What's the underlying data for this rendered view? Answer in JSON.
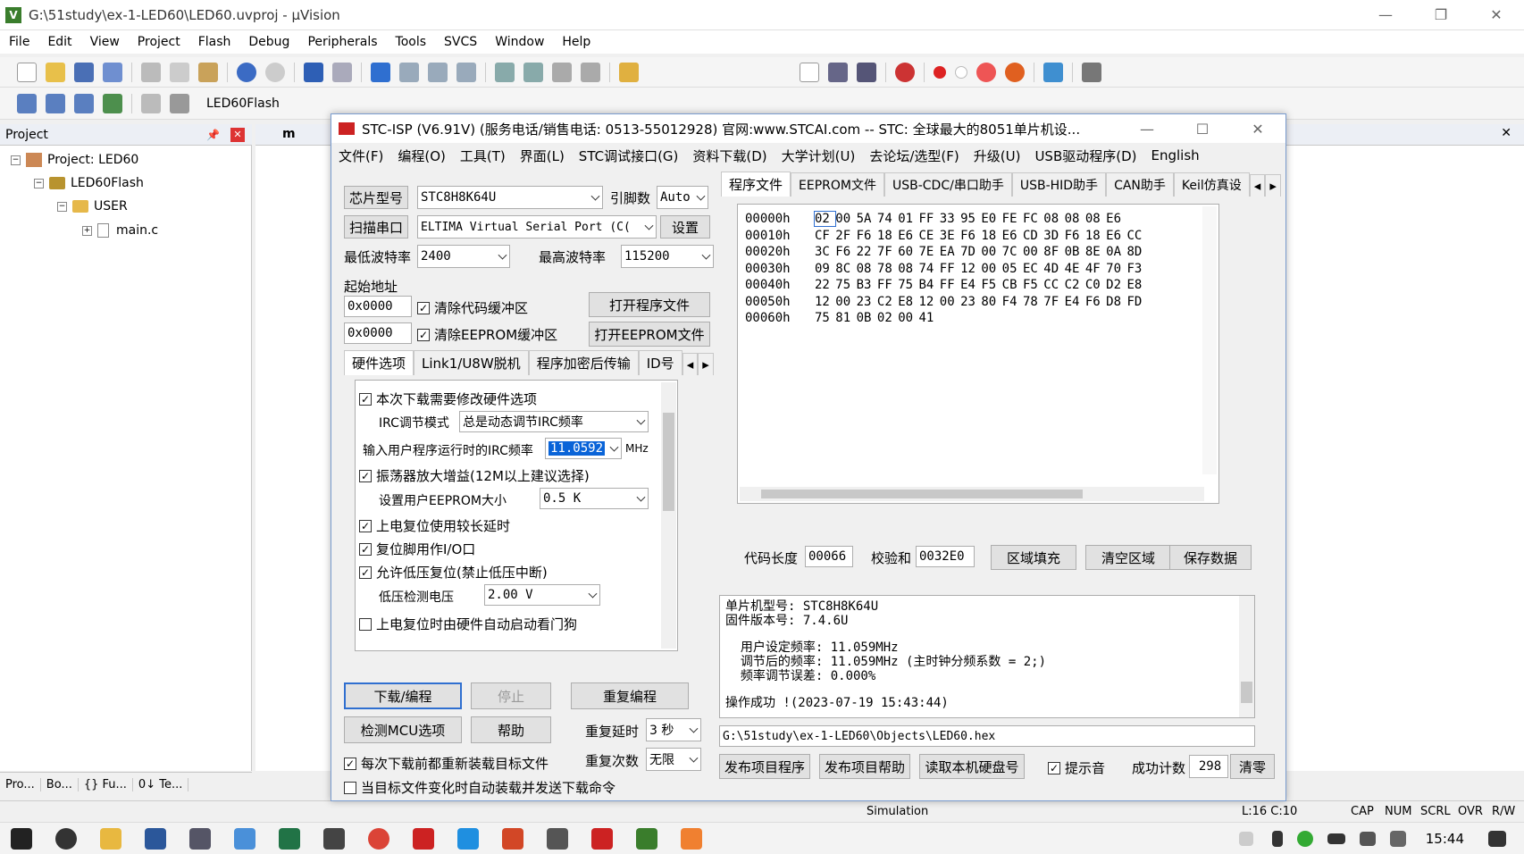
{
  "window_title": "G:\\51study\\ex-1-LED60\\LED60.uvproj - µVision",
  "menu": [
    "File",
    "Edit",
    "View",
    "Project",
    "Flash",
    "Debug",
    "Peripherals",
    "Tools",
    "SVCS",
    "Window",
    "Help"
  ],
  "target_name": "LED60Flash",
  "project_panel": {
    "title": "Project",
    "root": "Project: LED60",
    "target": "LED60Flash",
    "group": "USER",
    "file": "main.c",
    "tabs": [
      "Pro...",
      "Bo...",
      "{} Fu...",
      "0↓ Te..."
    ]
  },
  "editor_tab": "m",
  "statusbar": {
    "mode": "Simulation",
    "pos": "L:16 C:10",
    "flags": [
      "CAP",
      "NUM",
      "SCRL",
      "OVR",
      "R/W"
    ]
  },
  "taskbar": {
    "time": "15:44"
  },
  "stc": {
    "title": "STC-ISP (V6.91V) (服务电话/销售电话: 0513-55012928) 官网:www.STCAI.com  -- STC: 全球最大的8051单片机设...",
    "menu": [
      "文件(F)",
      "编程(O)",
      "工具(T)",
      "界面(L)",
      "STC调试接口(G)",
      "资料下载(D)",
      "大学计划(U)",
      "去论坛/选型(F)",
      "升级(U)",
      "USB驱动程序(D)",
      "English"
    ],
    "chip_btn": "芯片型号",
    "chip_value": "STC8H8K64U",
    "pins_label": "引脚数",
    "pins_value": "Auto",
    "scan_btn": "扫描串口",
    "port_value": "ELTIMA Virtual Serial Port (C(",
    "settings_btn": "设置",
    "min_baud_label": "最低波特率",
    "min_baud": "2400",
    "max_baud_label": "最高波特率",
    "max_baud": "115200",
    "start_addr_label": "起始地址",
    "addr1": "0x0000",
    "clear_code": "清除代码缓冲区",
    "open_prog": "打开程序文件",
    "addr2": "0x0000",
    "clear_eeprom": "清除EEPROM缓冲区",
    "open_eeprom": "打开EEPROM文件",
    "hw_tabs": [
      "硬件选项",
      "Link1/U8W脱机",
      "程序加密后传输",
      "ID号"
    ],
    "hw": {
      "opt_modify": "本次下载需要修改硬件选项",
      "irc_mode_label": "IRC调节模式",
      "irc_mode": "总是动态调节IRC频率",
      "irc_freq_label": "输入用户程序运行时的IRC频率",
      "irc_freq": "11.0592",
      "mhz": "MHz",
      "osc_gain": "振荡器放大增益(12M以上建议选择)",
      "eeprom_size_label": "设置用户EEPROM大小",
      "eeprom_size": "0.5 K",
      "long_delay": "上电复位使用较长延时",
      "reset_io": "复位脚用作I/O口",
      "lvr": "允许低压复位(禁止低压中断)",
      "lvd_label": "低压检测电压",
      "lvd": "2.00 V",
      "wdt": "上电复位时由硬件自动启动看门狗"
    },
    "download_btn": "下载/编程",
    "stop_btn": "停止",
    "reprogram_btn": "重复编程",
    "detect_btn": "检测MCU选项",
    "help_btn": "帮助",
    "repeat_delay_label": "重复延时",
    "repeat_delay": "3 秒",
    "repeat_count_label": "重复次数",
    "repeat_count": "无限",
    "reload_cb": "每次下载前都重新装载目标文件",
    "auto_cb": "当目标文件变化时自动装载并发送下载命令",
    "right_tabs": [
      "程序文件",
      "EEPROM文件",
      "USB-CDC/串口助手",
      "USB-HID助手",
      "CAN助手",
      "Keil仿真设"
    ],
    "hex": [
      {
        "addr": "00000h",
        "bytes": [
          "02",
          "00",
          "5A",
          "74",
          "01",
          "FF",
          "33",
          "95",
          "E0",
          "FE",
          "FC",
          "08",
          "08",
          "08",
          "E6"
        ]
      },
      {
        "addr": "00010h",
        "bytes": [
          "CF",
          "2F",
          "F6",
          "18",
          "E6",
          "CE",
          "3E",
          "F6",
          "18",
          "E6",
          "CD",
          "3D",
          "F6",
          "18",
          "E6",
          "CC"
        ]
      },
      {
        "addr": "00020h",
        "bytes": [
          "3C",
          "F6",
          "22",
          "7F",
          "60",
          "7E",
          "EA",
          "7D",
          "00",
          "7C",
          "00",
          "8F",
          "0B",
          "8E",
          "0A",
          "8D"
        ]
      },
      {
        "addr": "00030h",
        "bytes": [
          "09",
          "8C",
          "08",
          "78",
          "08",
          "74",
          "FF",
          "12",
          "00",
          "05",
          "EC",
          "4D",
          "4E",
          "4F",
          "70",
          "F3"
        ]
      },
      {
        "addr": "00040h",
        "bytes": [
          "22",
          "75",
          "B3",
          "FF",
          "75",
          "B4",
          "FF",
          "E4",
          "F5",
          "CB",
          "F5",
          "CC",
          "C2",
          "C0",
          "D2",
          "E8"
        ]
      },
      {
        "addr": "00050h",
        "bytes": [
          "12",
          "00",
          "23",
          "C2",
          "E8",
          "12",
          "00",
          "23",
          "80",
          "F4",
          "78",
          "7F",
          "E4",
          "F6",
          "D8",
          "FD"
        ]
      },
      {
        "addr": "00060h",
        "bytes": [
          "75",
          "81",
          "0B",
          "02",
          "00",
          "41"
        ]
      }
    ],
    "code_len_label": "代码长度",
    "code_len": "00066",
    "checksum_label": "校验和",
    "checksum": "0032E0",
    "fill_btn": "区域填充",
    "clear_btn": "清空区域",
    "save_btn": "保存数据",
    "log": [
      "单片机型号: STC8H8K64U",
      "固件版本号: 7.4.6U",
      "",
      "  用户设定频率: 11.059MHz",
      "  调节后的频率: 11.059MHz (主时钟分频系数 = 2;)",
      "  频率调节误差: 0.000%",
      "",
      "操作成功 !(2023-07-19 15:43:44)"
    ],
    "hex_path": "G:\\51study\\ex-1-LED60\\Objects\\LED60.hex",
    "publish_prog_btn": "发布项目程序",
    "publish_help_btn": "发布项目帮助",
    "read_disk_btn": "读取本机硬盘号",
    "sound_cb": "提示音",
    "success_label": "成功计数",
    "success_count": "298",
    "clear_count_btn": "清零"
  }
}
